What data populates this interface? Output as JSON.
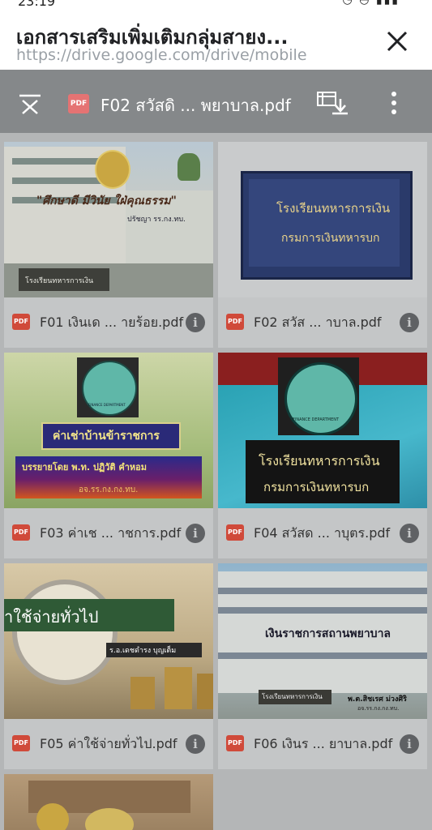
{
  "status": {
    "time": "23:19",
    "icons": "◔ ◓ ▮▮▮"
  },
  "browser": {
    "title": "เอกสารเสริมเพิ่มเติมกลุ่มสายง...",
    "url": "https://drive.google.com/drive/mobile"
  },
  "viewer": {
    "file_title": "F02 สวัสดิ ... พยาบาล.pdf",
    "badge": "PDF"
  },
  "files": [
    {
      "name": "F01 เงินเด ... ายร้อย.pdf",
      "badge": "PDF",
      "thumb": {
        "slogan": "\"ศึกษาดี  มีวินัย  ใฝ่คุณธรรม\"",
        "sub": "ปรัชญา รร.กง.ทบ.",
        "sign": "โรงเรียนทหารการเงิน"
      }
    },
    {
      "name": "F02 สวัส ... าบาล.pdf",
      "badge": "PDF",
      "thumb": {
        "line1": "โรงเรียนทหารการเงิน",
        "line2": "กรมการเงินทหารบก"
      }
    },
    {
      "name": "F03 ค่าเช ... าชการ.pdf",
      "badge": "PDF",
      "thumb": {
        "seal_text": "FINANCE DEPARTMENT",
        "title": "ค่าเช่าบ้านข้าราชการ",
        "lecturer": "บรรยายโดย  พ.ท. ปฏิวัติ       คำหอม",
        "org": "อจ.รร.กง.กง.ทบ."
      }
    },
    {
      "name": "F04 สวัสด ... าบุตร.pdf",
      "badge": "PDF",
      "thumb": {
        "seal_text": "FINANCE DEPARTMENT",
        "line1": "โรงเรียนทหารการเงิน",
        "line2": "กรมการเงินทหารบก"
      }
    },
    {
      "name": "F05 ค่าใช้จ่ายทั่วไป.pdf",
      "badge": "PDF",
      "thumb": {
        "title": "าใช้จ่ายทั่วไป",
        "author": "ร.อ.เดชดำรง  บุญเต็ม"
      }
    },
    {
      "name": "F06 เงินร ... ยาบาล.pdf",
      "badge": "PDF",
      "thumb": {
        "title": "เงินราชการสถานพยาบาล",
        "sign": "โรงเรียนทหารการเงิน",
        "author": "พ.ต.สิชเรศ ม่วงศิริ",
        "org": "อจ.รร.กง.กง.ทบ."
      }
    }
  ],
  "colors": {
    "overlay": "#b4b6b7",
    "viewer_bar": "#85888a",
    "pdf_red": "#d04a3a"
  }
}
